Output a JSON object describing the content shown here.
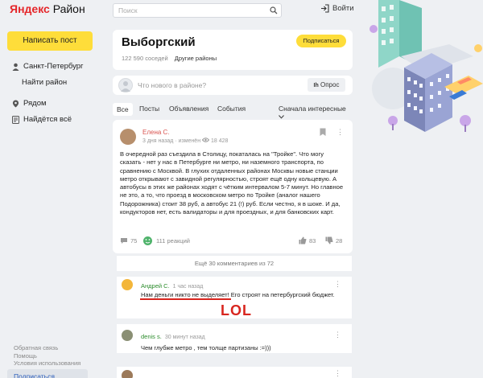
{
  "app": {
    "logo_brand": "Яндекс",
    "logo_product": "Район"
  },
  "sidebar": {
    "write_post": "Написать пост",
    "city": "Санкт-Петербург",
    "find_district": "Найти район",
    "nearby": "Рядом",
    "found": "Найдётся всё",
    "footer": [
      "Обратная связь",
      "Помощь",
      "Условия использования"
    ],
    "subscribe": "Подписаться"
  },
  "topbar": {
    "search_placeholder": "Поиск",
    "login": "Войти"
  },
  "district": {
    "title": "Выборгский",
    "neighbors": "122 590 соседей",
    "other": "Другие районы",
    "subscribe": "Подписаться"
  },
  "compose": {
    "placeholder": "Что нового в районе?",
    "poll": "Опрос"
  },
  "tabs": [
    "Все",
    "Посты",
    "Объявления",
    "События"
  ],
  "sort": "Сначала интересные",
  "post": {
    "author": "Елена С.",
    "time": "3 дня назад · изменён",
    "views": "18 428",
    "text": "В очередной раз съездила в Столицу, покаталась на \"Тройке\". Что могу сказать - нет у нас в Петербурге ни метро, ни наземного транспорта, по сравнению с Москвой. В глухих отдаленных районах Москвы новые станции метро открывают с завидной регулярностью, строят ещё одну кольцевую. А автобусы в этих же районах ходят с чётким интервалом 5-7 минут. Но главное не это, а то, что проезд в московском метро по Тройке (аналог нашего Подорожника) стоит 38 руб, а автобус 21 (!) руб. Если честно, я в шоке. И да, кондукторов нет, есть валидаторы и для проездных, и для банковских карт.",
    "comments": "75",
    "reactions": "111 реакций",
    "up": "83",
    "down": "28"
  },
  "more_comments": "Ещё 30 комментариев из 72",
  "comments": [
    {
      "author": "Андрей С.",
      "time": "1 час назад",
      "text_underlined": "Нам деньги никто не выделяет",
      "text_rest": "! Его строят на петербургский бюджет."
    },
    {
      "author": "denis s.",
      "time": "30 минут назад",
      "text": "Чем глубже метро , тем толще партизаны :=)))"
    }
  ],
  "annotation": "LOL",
  "colors": {
    "accent_yellow": "#fedd3a",
    "logo_red": "#e5262a",
    "comment_name_green": "#2c8c2c",
    "annotation_red": "#d8261f"
  }
}
